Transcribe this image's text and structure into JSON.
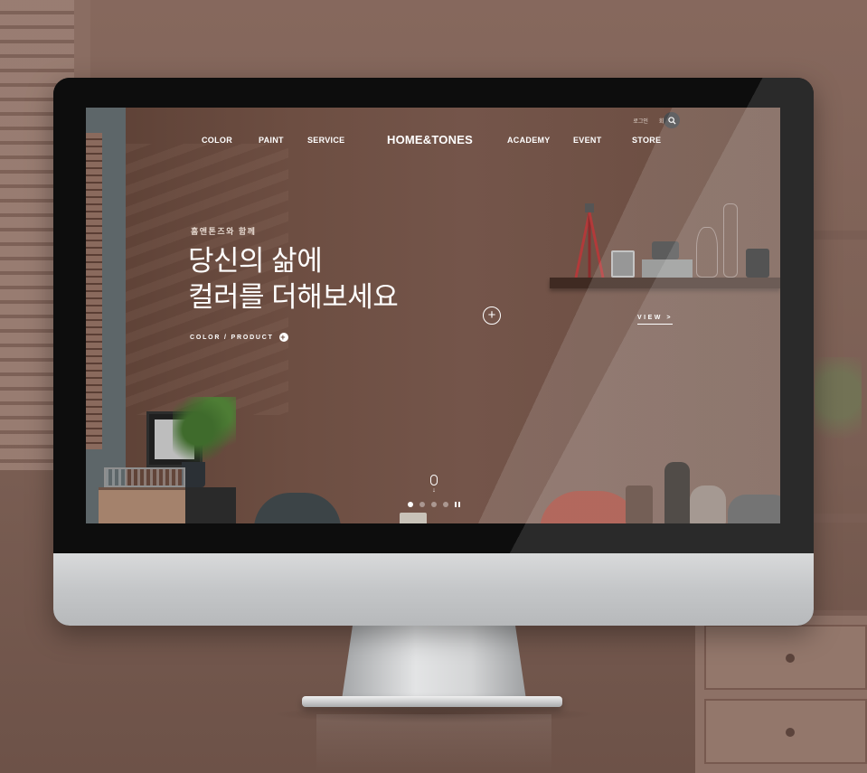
{
  "website": {
    "util_links": [
      "로그인",
      "회원가입"
    ],
    "search_icon": "search-icon",
    "nav_left": [
      "COLOR",
      "PAINT",
      "SERVICE"
    ],
    "logo": "HOME&TONES",
    "nav_right": [
      "ACADEMY",
      "EVENT",
      "STORE"
    ],
    "hero": {
      "eyebrow": "홈앤톤즈와 함께",
      "title_line1": "당신의 삶에",
      "title_line2": "컬러를 더해보세요",
      "link_label": "COLOR / PRODUCT",
      "hotspot_symbol": "+",
      "view_label": "VIEW  >"
    },
    "slider": {
      "slide_count": 4,
      "active_index": 0
    }
  },
  "colors": {
    "wall": "#6d4e42",
    "room": "#7b5f54",
    "chair_accent": "#9b3a2c"
  }
}
